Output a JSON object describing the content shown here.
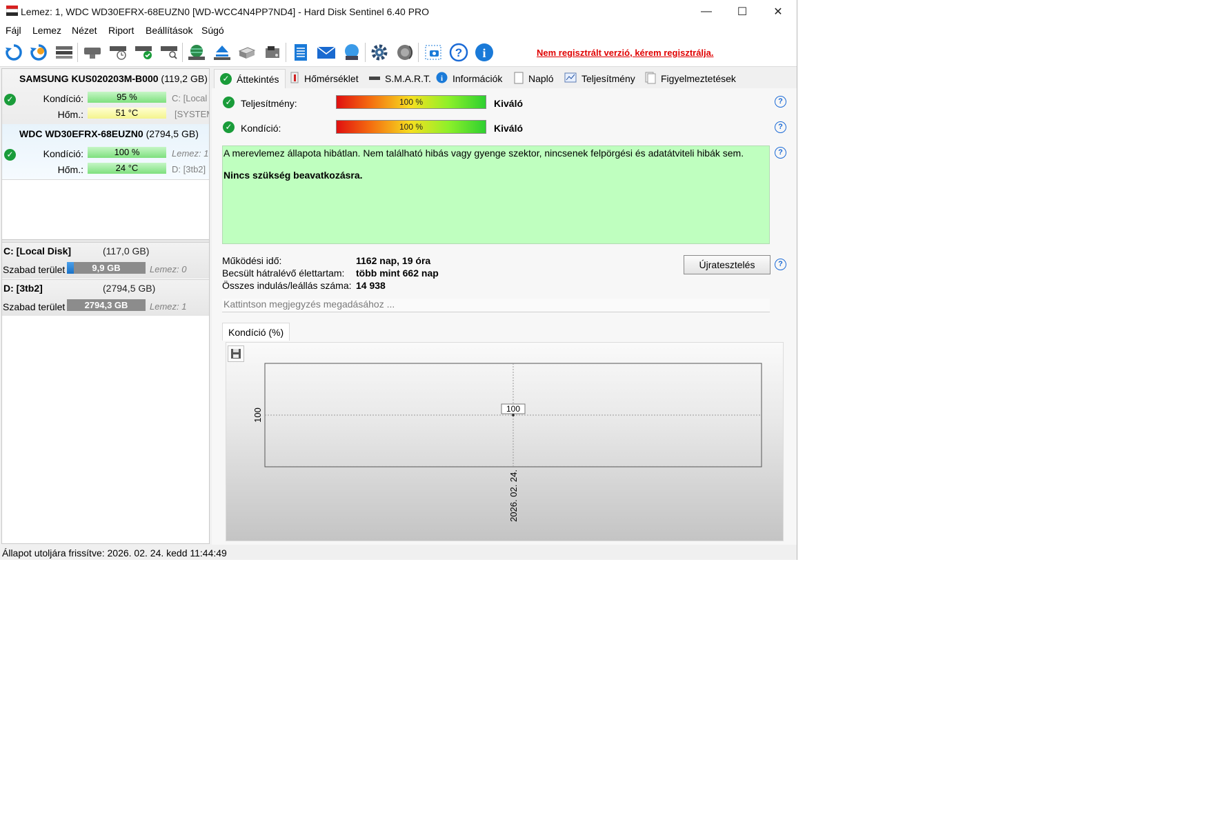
{
  "window": {
    "title": "Lemez: 1, WDC WD30EFRX-68EUZN0 [WD-WCC4N4PP7ND4]  -  Hard Disk Sentinel 6.40 PRO",
    "minimize": "—",
    "maximize": "☐",
    "close": "✕"
  },
  "menu": [
    "Fájl",
    "Lemez",
    "Nézet",
    "Riport",
    "Beállítások",
    "Súgó"
  ],
  "toolbar": {
    "icons": [
      "refresh-icon",
      "refresh-all-icon",
      "disk-list-icon",
      "disk-icon",
      "disk-schedule-icon",
      "disk-ok-icon",
      "disk-search-icon",
      "web-icon",
      "eject-icon",
      "drives-icon",
      "drive-icon",
      "report-icon",
      "mail-icon",
      "network-icon",
      "settings-icon",
      "sound-icon",
      "screenshot-icon",
      "help-icon",
      "info-icon"
    ],
    "register_link": "Nem regisztrált verzió, kérem regisztrálja."
  },
  "disks": [
    {
      "name": "SAMSUNG KUS020203M-B000",
      "size": "(119,2 GB)",
      "size_tail": "L",
      "condition_label": "Kondíció:",
      "condition_value": "95 %",
      "condition": 95,
      "temp_label": "Hőm.:",
      "temp_value": "51 °C",
      "drive1": "C: [Local",
      "drive2": "[SYSTEM"
    },
    {
      "name": "WDC WD30EFRX-68EUZN0",
      "size": "(2794,5 GB)",
      "size_tail": "",
      "condition_label": "Kondíció:",
      "condition_value": "100 %",
      "condition": 100,
      "temp_label": "Hőm.:",
      "temp_value": "24 °C",
      "drive1": "Lemez: 1",
      "drive2": "D: [3tb2]"
    }
  ],
  "volumes": [
    {
      "name": "C: [Local Disk]",
      "size": "(117,0 GB)",
      "free_label": "Szabad terület",
      "free_value": "9,9 GB",
      "free_fraction": 0.085,
      "disk": "Lemez: 0"
    },
    {
      "name": "D: [3tb2]",
      "size": "(2794,5 GB)",
      "free_label": "Szabad terület",
      "free_value": "2794,3 GB",
      "free_fraction": 1.0,
      "disk": "Lemez: 1"
    }
  ],
  "tabs": [
    "Áttekintés",
    "Hőmérséklet",
    "S.M.A.R.T.",
    "Információk",
    "Napló",
    "Teljesítmény",
    "Figyelmeztetések"
  ],
  "overview": {
    "performance_label": "Teljesítmény:",
    "performance_value": "100 %",
    "performance_rating": "Kiváló",
    "condition_label": "Kondíció:",
    "condition_value": "100 %",
    "condition_rating": "Kiváló",
    "status_line1": "A merevlemez állapota hibátlan. Nem található hibás vagy gyenge szektor, nincsenek felpörgési és adatátviteli hibák sem.",
    "status_line2": "Nincs szükség beavatkozásra.",
    "uptime_label": "Működési idő:",
    "uptime_value": "1162 nap, 19 óra",
    "remaining_label": "Becsült hátralévő élettartam:",
    "remaining_value": "több mint 662 nap",
    "starts_label": "Összes indulás/leállás száma:",
    "starts_value": "14 938",
    "retest_button": "Újratesztelés",
    "note_placeholder": "Kattintson megjegyzés megadásához ...",
    "chart_tab": "Kondíció  (%)"
  },
  "chart_data": {
    "type": "line",
    "x": [
      "2026. 02. 24."
    ],
    "series": [
      {
        "values": [
          100
        ]
      }
    ],
    "ylabel_tick": "100",
    "point_label": "100",
    "grid": true
  },
  "statusbar": {
    "text": "Állapot utoljára frissítve: 2026. 02. 24. kedd 11:44:49"
  }
}
